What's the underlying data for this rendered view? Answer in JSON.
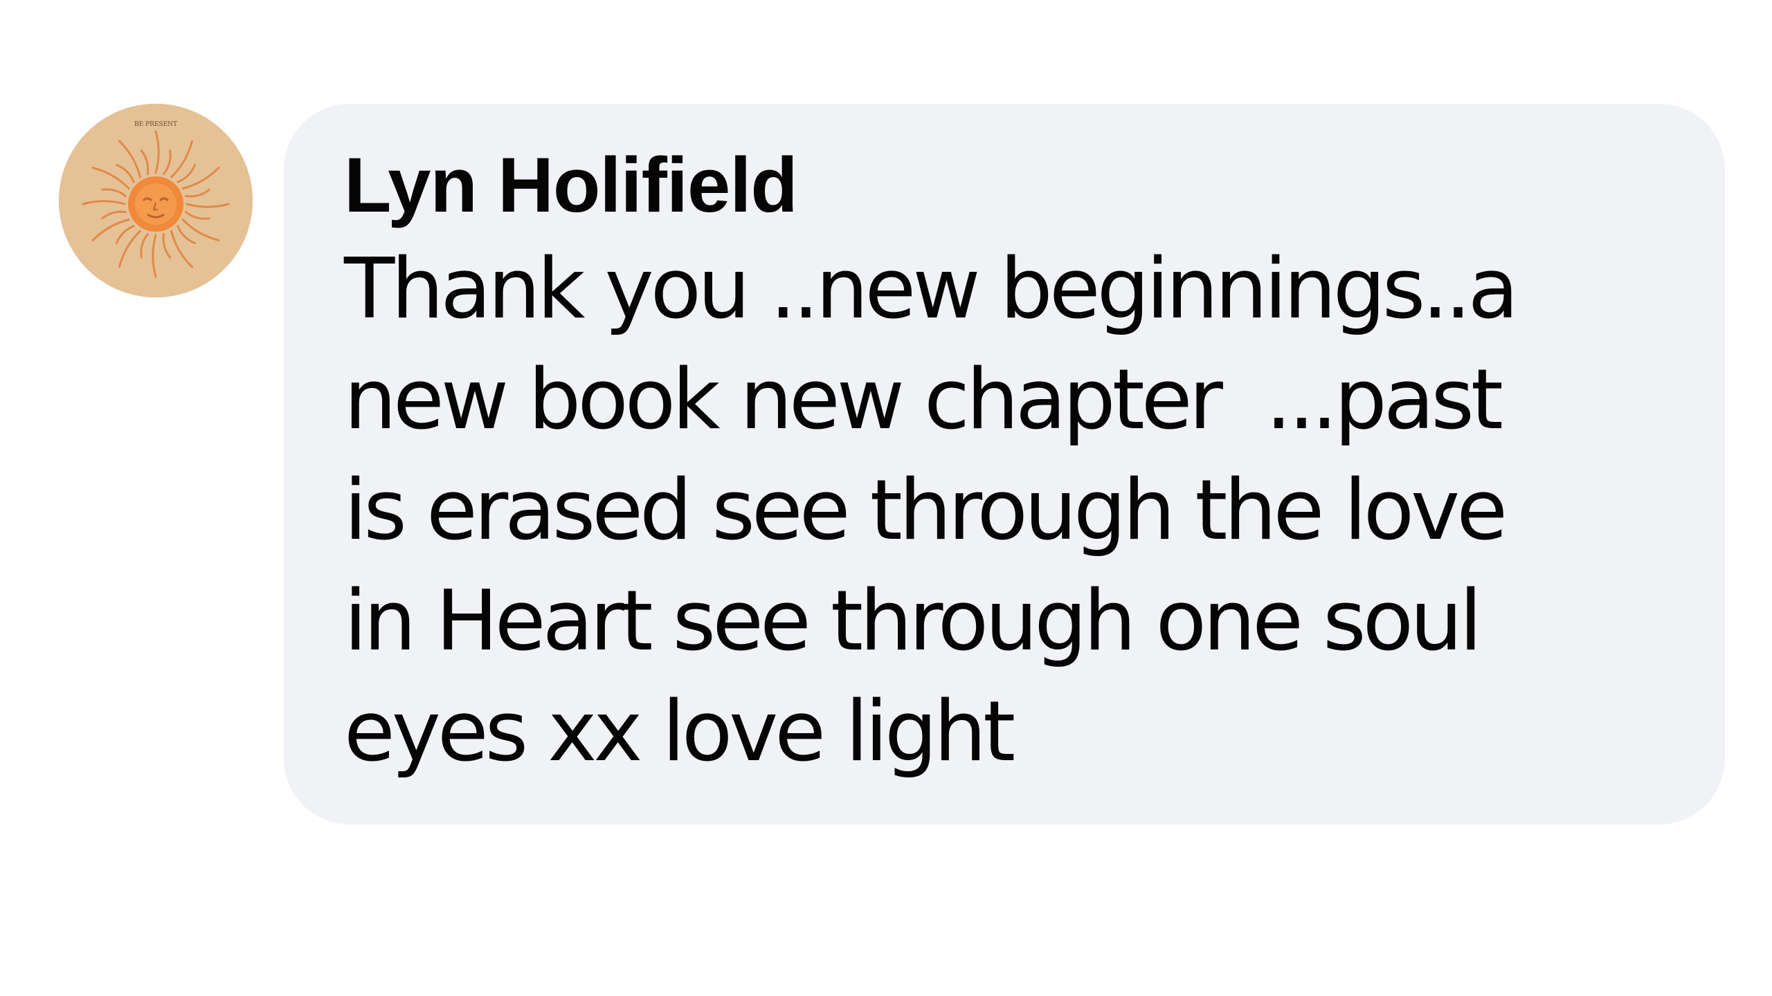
{
  "comment": {
    "author": "Lyn Holifield",
    "avatar_icon": "sun-face-icon",
    "avatar_caption": "BE PRESENT",
    "body_lines": [
      "Thank you ..new beginnings..a",
      "new book new chapter  ...past",
      "is erased see through the love",
      "in Heart see through one soul",
      "eyes xx love light"
    ]
  },
  "colors": {
    "bubble_background": "#f0f2f5",
    "text": "#050505",
    "avatar_background": "#e5c196",
    "sun": "#f08a3c"
  }
}
